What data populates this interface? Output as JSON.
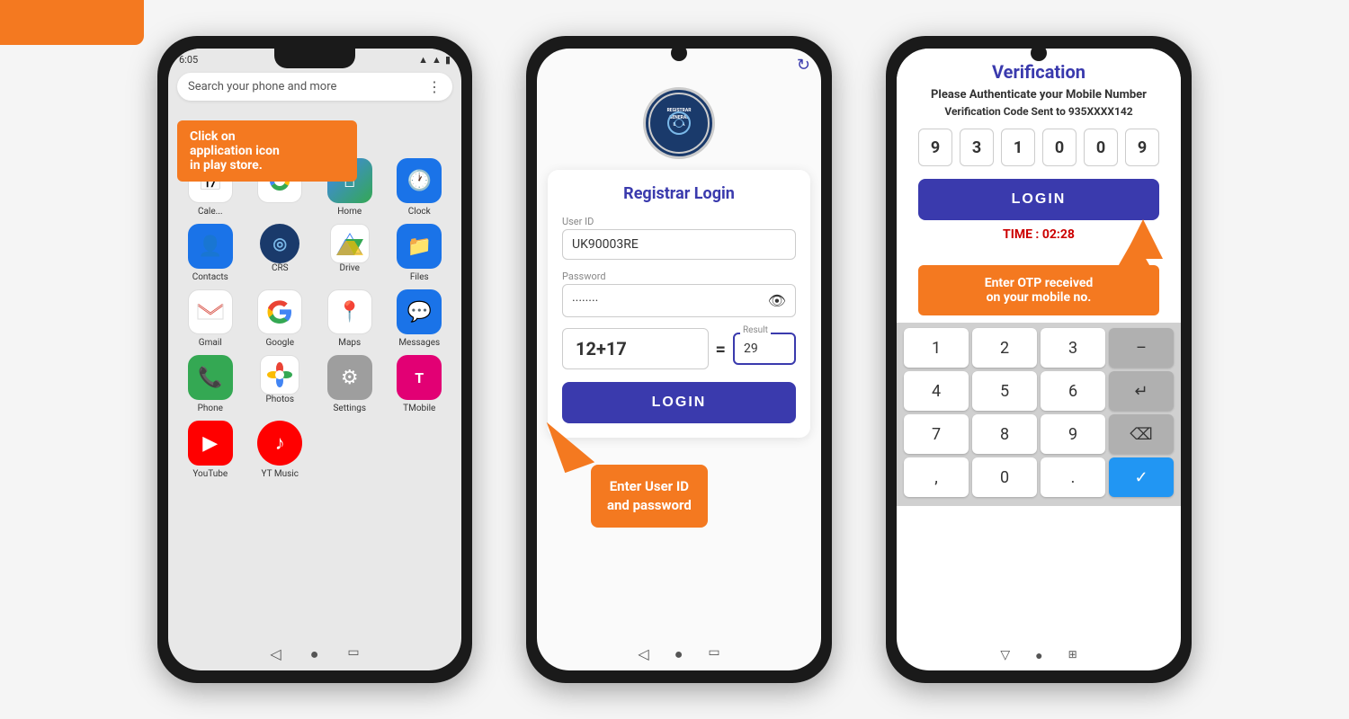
{
  "page": {
    "background": "#f5f5f5"
  },
  "phone1": {
    "status_time": "6:05",
    "search_placeholder": "Search your phone and more",
    "tooltip": {
      "line1": "Click on",
      "line2": "application icon",
      "line3": "in play store."
    },
    "row1": [
      {
        "id": "calendar",
        "label": "Cale...",
        "icon_char": "📅",
        "css_class": "icon-calendar"
      },
      {
        "id": "chrome",
        "label": "",
        "icon_char": "●",
        "css_class": "icon-chrome"
      },
      {
        "id": "home",
        "label": "Home",
        "icon_char": "⌂",
        "css_class": "icon-home"
      },
      {
        "id": "clock",
        "label": "Clock",
        "icon_char": "🕐",
        "css_class": "icon-clock"
      }
    ],
    "row2": [
      {
        "id": "contacts",
        "label": "Contacts",
        "icon_char": "👤",
        "css_class": "icon-contacts"
      },
      {
        "id": "crs",
        "label": "CRS",
        "icon_char": "◎",
        "css_class": "crs-special"
      },
      {
        "id": "drive",
        "label": "Drive",
        "icon_char": "▲",
        "css_class": "icon-drive"
      },
      {
        "id": "files",
        "label": "Files",
        "icon_char": "📁",
        "css_class": "icon-files"
      }
    ],
    "row3": [
      {
        "id": "gmail",
        "label": "Gmail",
        "icon_char": "M",
        "css_class": "icon-gmail"
      },
      {
        "id": "google",
        "label": "Google",
        "icon_char": "G",
        "css_class": "icon-google"
      },
      {
        "id": "maps",
        "label": "Maps",
        "icon_char": "📍",
        "css_class": "icon-maps"
      },
      {
        "id": "messages",
        "label": "Messages",
        "icon_char": "💬",
        "css_class": "icon-messages"
      }
    ],
    "row4": [
      {
        "id": "phone",
        "label": "Phone",
        "icon_char": "📞",
        "css_class": "icon-phone"
      },
      {
        "id": "photos",
        "label": "Photos",
        "icon_char": "❋",
        "css_class": "icon-photos"
      },
      {
        "id": "settings",
        "label": "Settings",
        "icon_char": "⚙",
        "css_class": "icon-settings"
      },
      {
        "id": "tmobile",
        "label": "TMobile",
        "icon_char": "T",
        "css_class": "icon-tmobile"
      }
    ],
    "row5": [
      {
        "id": "youtube",
        "label": "YouTube",
        "icon_char": "▶",
        "css_class": "icon-youtube"
      },
      {
        "id": "ytmusic",
        "label": "YT Music",
        "icon_char": "♪",
        "css_class": "icon-ytmusic"
      },
      {
        "id": "empty1",
        "label": "",
        "icon_char": "",
        "css_class": ""
      },
      {
        "id": "empty2",
        "label": "",
        "icon_char": "",
        "css_class": ""
      }
    ]
  },
  "phone2": {
    "logo_text": "REGISTRAR GENERAL INDIA",
    "login_title": "Registrar Login",
    "userid_label": "User ID",
    "userid_value": "UK90003RE",
    "password_label": "Password",
    "password_dots": "········",
    "captcha_expr": "12+17",
    "captcha_equals": "=",
    "captcha_result_label": "Result",
    "captcha_result_value": "29",
    "login_button": "LOGIN",
    "tooltip": {
      "line1": "Enter User ID",
      "line2": "and password"
    }
  },
  "phone3": {
    "screen_title": "Verification",
    "subtitle": "Please Authenticate your Mobile Number",
    "code_sent": "Verification Code Sent to 935XXXX142",
    "otp_digits": [
      "9",
      "3",
      "1",
      "0",
      "0",
      "9"
    ],
    "login_button": "LOGIN",
    "timer_label": "TIME : 02:28",
    "tooltip": {
      "line1": "Enter OTP received",
      "line2": "on your mobile no."
    },
    "keypad": {
      "rows": [
        [
          "1",
          "2",
          "3",
          "–"
        ],
        [
          "4",
          "5",
          "6",
          "↵"
        ],
        [
          "7",
          "8",
          "9",
          "⌫"
        ],
        [
          ",",
          "0",
          ".",
          "✓"
        ]
      ]
    }
  }
}
